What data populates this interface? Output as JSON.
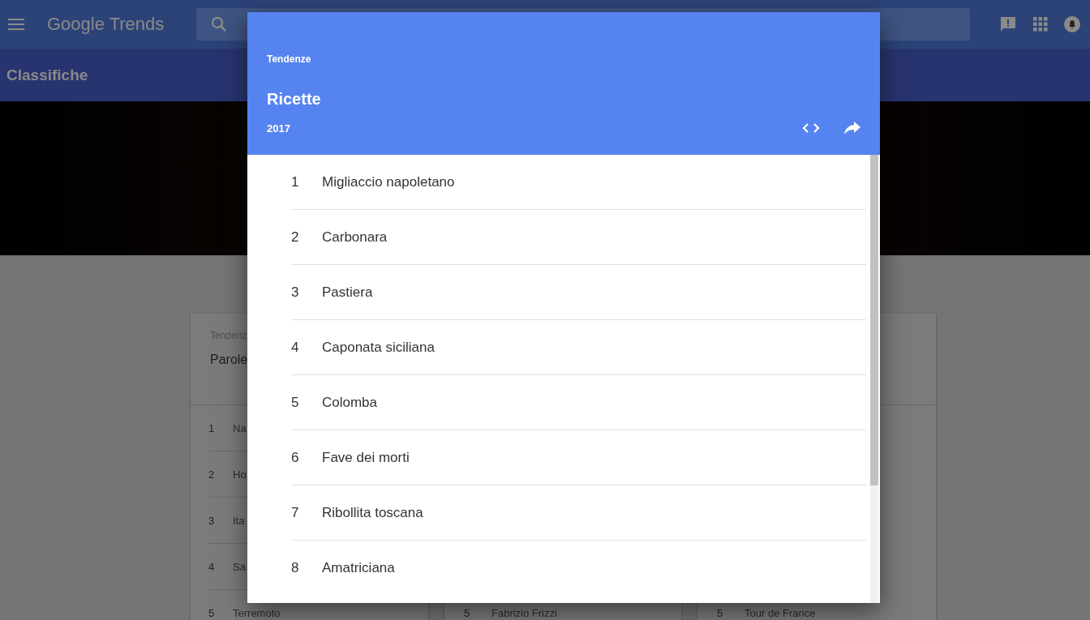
{
  "topbar": {
    "logo": "Google Trends"
  },
  "subheader": {
    "title": "Classifiche"
  },
  "cards": [
    {
      "label": "Tendenz",
      "title": "Parole",
      "rows": [
        {
          "rank": "1",
          "name": "Na"
        },
        {
          "rank": "2",
          "name": "Ho"
        },
        {
          "rank": "3",
          "name": "Ita"
        },
        {
          "rank": "4",
          "name": "Sa"
        },
        {
          "rank": "5",
          "name": "Terremoto"
        }
      ]
    },
    {
      "rows": [
        {
          "rank": "5",
          "name": "Fabrizio Frizzi"
        }
      ]
    },
    {
      "rows": [
        {
          "rank": "5",
          "name": "Tour de France"
        }
      ]
    }
  ],
  "dialog": {
    "label": "Tendenze",
    "title": "Ricette",
    "year": "2017",
    "items": [
      {
        "rank": "1",
        "name": "Migliaccio napoletano"
      },
      {
        "rank": "2",
        "name": "Carbonara"
      },
      {
        "rank": "3",
        "name": "Pastiera"
      },
      {
        "rank": "4",
        "name": "Caponata siciliana"
      },
      {
        "rank": "5",
        "name": "Colomba"
      },
      {
        "rank": "6",
        "name": "Fave dei morti"
      },
      {
        "rank": "7",
        "name": "Ribollita toscana"
      },
      {
        "rank": "8",
        "name": "Amatriciana"
      }
    ]
  }
}
